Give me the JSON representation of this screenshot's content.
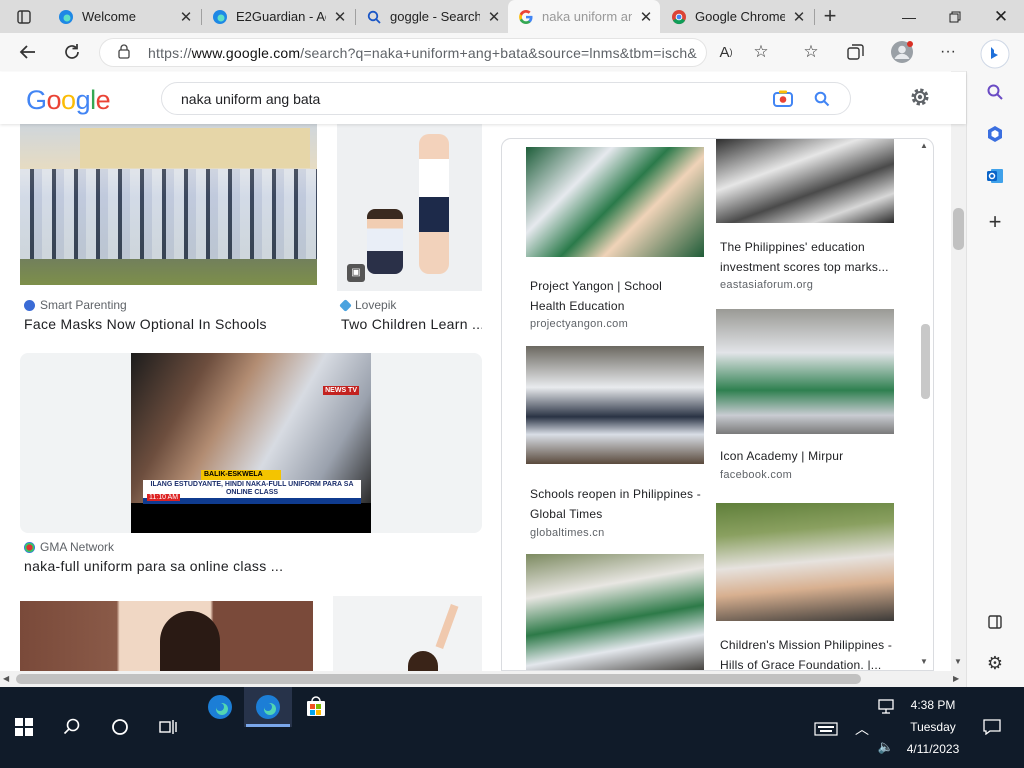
{
  "tabs": [
    {
      "title": "Welcome",
      "active": false
    },
    {
      "title": "E2Guardian - Ac",
      "active": false
    },
    {
      "title": "goggle - Search",
      "active": false
    },
    {
      "title": "naka uniform an",
      "active": true
    },
    {
      "title": "Google Chrome",
      "active": false
    }
  ],
  "browser": {
    "url_prefix": "https://",
    "url_domain": "www.google.com",
    "url_rest": "/search?q=naka+uniform+ang+bata&source=lnms&tbm=isch&..."
  },
  "google": {
    "logo": [
      "G",
      "o",
      "o",
      "g",
      "l",
      "e"
    ],
    "logo_colors": [
      "#4285f4",
      "#ea4335",
      "#fbbc05",
      "#4285f4",
      "#34a853",
      "#ea4335"
    ],
    "query": "naka uniform ang bata"
  },
  "results": [
    {
      "source": "Smart Parenting",
      "caption": "Face Masks Now Optional In Schools"
    },
    {
      "source": "Lovepik",
      "caption": "Two Children Learn ..."
    },
    {
      "source": "GMA Network",
      "caption": "naka-full uniform para sa online class ..."
    }
  ],
  "video": {
    "banner_top": "BALIK-ESKWELA",
    "banner_main": "ILANG ESTUDYANTE, HINDI NAKA-FULL UNIFORM PARA SA ONLINE CLASS",
    "time": "11:10 AM",
    "channel": "NEWS TV"
  },
  "panel": [
    {
      "title": "Project Yangon | School Health Education",
      "domain": "projectyangon.com"
    },
    {
      "title": "The Philippines' education investment scores top marks...",
      "domain": "eastasiaforum.org"
    },
    {
      "title": "Schools reopen in Philippines - Global Times",
      "domain": "globaltimes.cn"
    },
    {
      "title": "Icon Academy | Mirpur",
      "domain": "facebook.com"
    },
    {
      "title": "Children's Mission Philippines - Hills of Grace Foundation. |...",
      "domain": ""
    }
  ],
  "clock": {
    "time": "4:38 PM",
    "day": "Tuesday",
    "date": "4/11/2023"
  },
  "colors": {
    "taskbar": "#101b29",
    "tabbar": "#dcdcdc",
    "accent": "#1a73e8"
  }
}
